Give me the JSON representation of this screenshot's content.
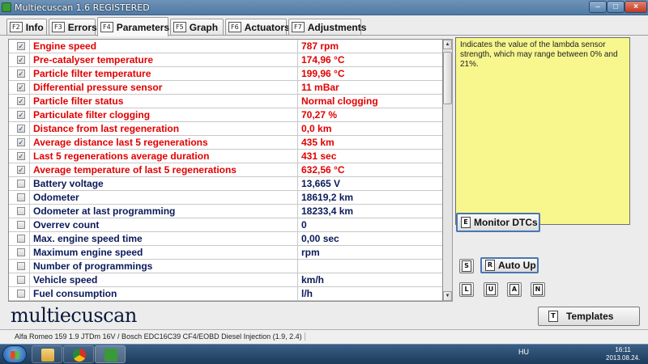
{
  "window": {
    "title": "Multiecuscan 1.6 REGISTERED"
  },
  "tabs": [
    {
      "key": "F2",
      "label": "Info"
    },
    {
      "key": "F3",
      "label": "Errors"
    },
    {
      "key": "F4",
      "label": "Parameters",
      "active": true
    },
    {
      "key": "F5",
      "label": "Graph"
    },
    {
      "key": "F6",
      "label": "Actuators"
    },
    {
      "key": "F7",
      "label": "Adjustments"
    }
  ],
  "parameters": [
    {
      "checked": true,
      "name": "Engine speed",
      "value": "787 rpm"
    },
    {
      "checked": true,
      "name": "Pre-catalyser temperature",
      "value": "174,96 °C"
    },
    {
      "checked": true,
      "name": "Particle filter temperature",
      "value": "199,96 °C"
    },
    {
      "checked": true,
      "name": "Differential pressure sensor",
      "value": "11 mBar"
    },
    {
      "checked": true,
      "name": "Particle filter status",
      "value": "Normal clogging"
    },
    {
      "checked": true,
      "name": "Particulate filter clogging",
      "value": "70,27 %"
    },
    {
      "checked": true,
      "name": "Distance from last regeneration",
      "value": "0,0 km"
    },
    {
      "checked": true,
      "name": "Average distance last 5 regenerations",
      "value": "435 km"
    },
    {
      "checked": true,
      "name": "Last 5 regenerations average duration",
      "value": "431 sec"
    },
    {
      "checked": true,
      "name": "Average temperature of last 5 regenerations",
      "value": "632,56 °C"
    },
    {
      "checked": false,
      "name": "Battery voltage",
      "value": "13,665 V"
    },
    {
      "checked": false,
      "name": "Odometer",
      "value": "18619,2 km"
    },
    {
      "checked": false,
      "name": "Odometer at last programming",
      "value": "18233,4 km"
    },
    {
      "checked": false,
      "name": "Overrev count",
      "value": "0"
    },
    {
      "checked": false,
      "name": "Max. engine speed time",
      "value": "0,00 sec"
    },
    {
      "checked": false,
      "name": "Maximum engine speed",
      "value": " rpm"
    },
    {
      "checked": false,
      "name": "Number of programmings",
      "value": ""
    },
    {
      "checked": false,
      "name": "Vehicle speed",
      "value": " km/h"
    },
    {
      "checked": false,
      "name": "Fuel consumption",
      "value": "l/h"
    }
  ],
  "help_text": "Indicates the value of the lambda sensor strength, which may range between 0% and 21%.",
  "buttons": {
    "monitor": {
      "key": "E",
      "label": "Monitor DTCs"
    },
    "s": {
      "key": "S"
    },
    "autoup": {
      "key": "R",
      "label": "Auto Up"
    },
    "l": {
      "key": "L"
    },
    "u": {
      "key": "U"
    },
    "a": {
      "key": "A"
    },
    "n": {
      "key": "N"
    },
    "templates": {
      "key": "T",
      "label": "Templates"
    }
  },
  "logo_text": "multiecuscan",
  "status_text": "Alfa Romeo 159 1.9 JTDm 16V / Bosch EDC16C39 CF4/EOBD Diesel Injection (1.9, 2.4)",
  "taskbar": {
    "language": "HU",
    "time": "16:11",
    "date": "2013.08.24."
  },
  "colors": {
    "active_param": "#e10000",
    "idle_param": "#0b1a5a",
    "help_bg": "#f7f78e",
    "accent_border": "#4a75b2"
  }
}
